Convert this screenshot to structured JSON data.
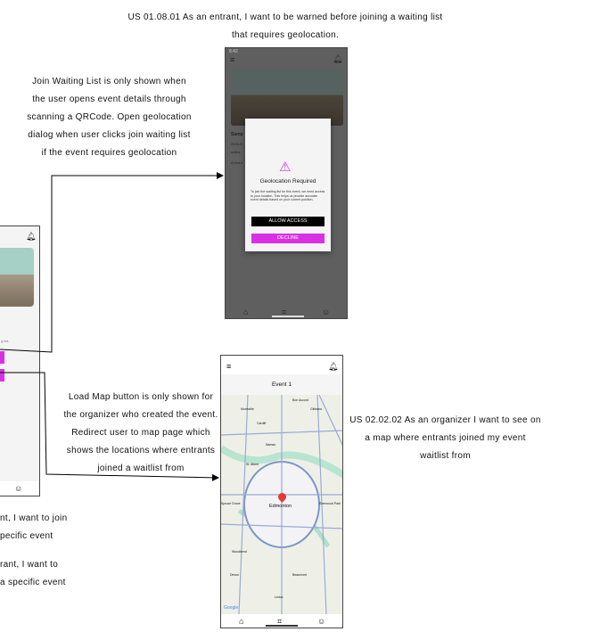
{
  "notes": {
    "us_geo": "US 01.08.01 As an entrant, I want to be warned before joining a waiting list that requires geolocation.",
    "join_note": "Join Waiting List is only shown when the user opens event details through scanning a QRCode. Open geolocation dialog when user clicks join waiting list if the event requires geolocation",
    "map_note": "Load Map button is only shown for the organizer who created the event. Redirect user to map page which shows the locations where entrants joined a waitlist from",
    "us_map": "US 02.02.02 As an organizer I want to see on a map where entrants joined my event waitlist from",
    "left_1a": "nt, I want to join",
    "left_1b": "pecific event",
    "left_2a": "rant, I want to",
    "left_2b": "a specific event"
  },
  "geo_phone": {
    "status_time": "8:42",
    "event_title": "Samp",
    "event_date": "2023-0",
    "event_loc": "online",
    "event_desc": "A test e",
    "dialog": {
      "title": "Geolocation Required",
      "body": "To join the waiting list for this event, we need access to your location. This helps us provide accurate event details based on your current position.",
      "allow": "ALLOW ACCESS",
      "decline": "DECLINE"
    }
  },
  "left_phone": {
    "snippet": "g list."
  },
  "map_phone": {
    "title": "Event 1",
    "center_label": "Edmonton",
    "places": [
      "Morinville",
      "Cardiff",
      "Gibbons",
      "Bon Accord",
      "Namao",
      "St. Albert",
      "Sherwood Park",
      "Beaumont",
      "Devon",
      "Leduc",
      "Woodbend",
      "Spruce Grove"
    ],
    "attribution": "Google"
  },
  "colors": {
    "accent": "#d930e6",
    "pin": "#e53935"
  }
}
